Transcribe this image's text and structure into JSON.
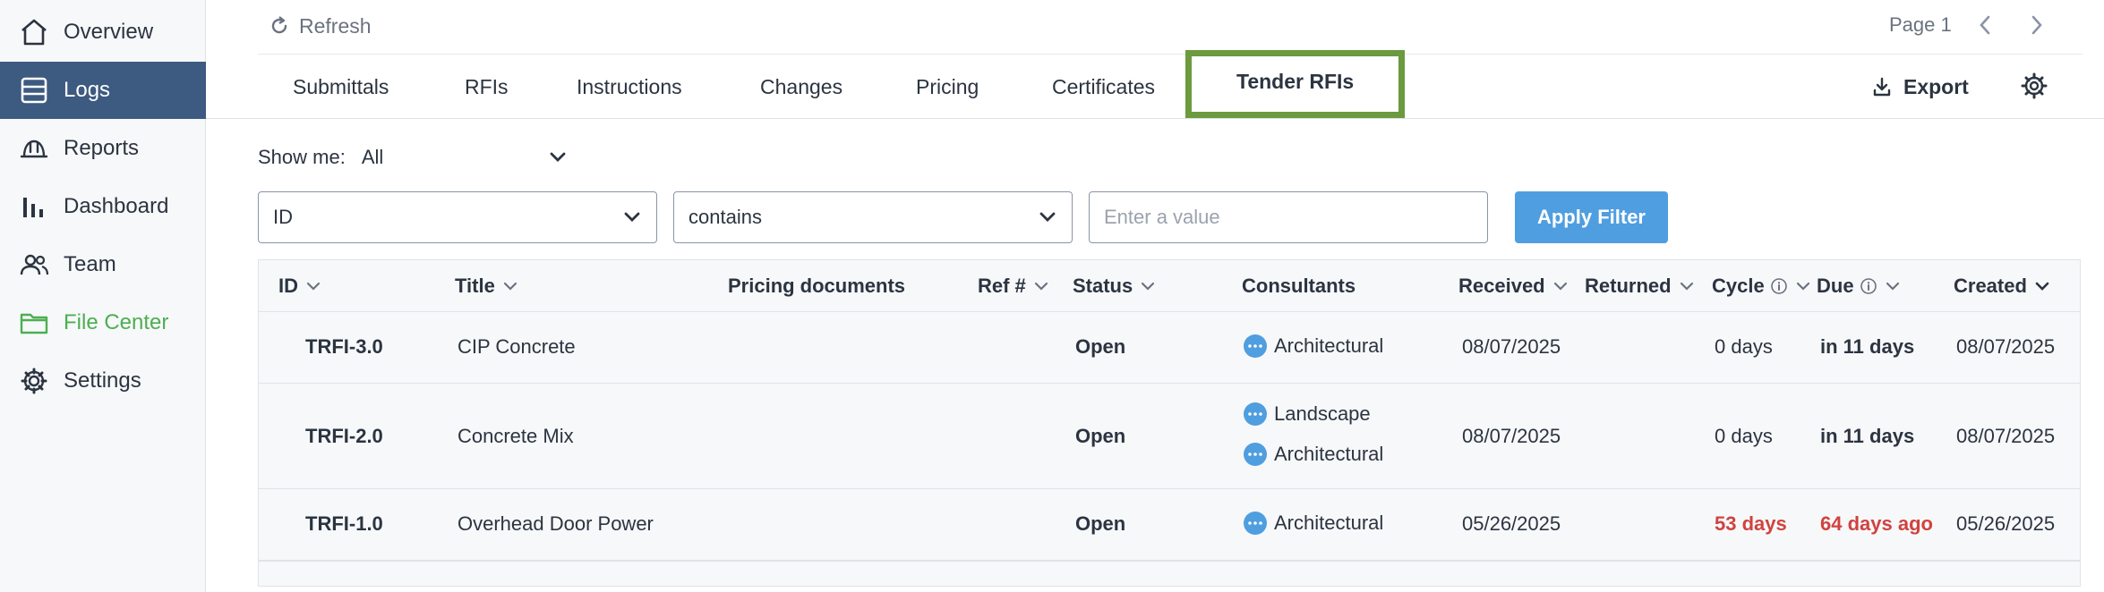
{
  "sidebar": {
    "items": [
      {
        "label": "Overview",
        "icon": "home-icon"
      },
      {
        "label": "Logs",
        "icon": "logs-icon",
        "active": true
      },
      {
        "label": "Reports",
        "icon": "hard-hat-icon"
      },
      {
        "label": "Dashboard",
        "icon": "bar-chart-icon"
      },
      {
        "label": "Team",
        "icon": "team-icon"
      },
      {
        "label": "File Center",
        "icon": "folder-icon"
      },
      {
        "label": "Settings",
        "icon": "gear-icon"
      }
    ]
  },
  "toolbar": {
    "refresh_label": "Refresh",
    "page_label": "Page 1",
    "export_label": "Export"
  },
  "tabs": [
    {
      "label": "Submittals"
    },
    {
      "label": "RFIs"
    },
    {
      "label": "Instructions"
    },
    {
      "label": "Changes"
    },
    {
      "label": "Pricing"
    },
    {
      "label": "Certificates"
    },
    {
      "label": "Tender RFIs",
      "active": true
    }
  ],
  "show_me": {
    "label": "Show me:",
    "value": "All"
  },
  "filter": {
    "field": "ID",
    "operator": "contains",
    "value_placeholder": "Enter a value",
    "apply_label": "Apply Filter"
  },
  "table": {
    "columns": {
      "id": "ID",
      "title": "Title",
      "pricing_documents": "Pricing documents",
      "ref": "Ref #",
      "status": "Status",
      "consultants": "Consultants",
      "received": "Received",
      "returned": "Returned",
      "cycle": "Cycle",
      "due": "Due",
      "created": "Created"
    },
    "rows": [
      {
        "id": "TRFI-3.0",
        "title": "CIP Concrete",
        "status": "Open",
        "consultants": [
          "Architectural"
        ],
        "received": "08/07/2025",
        "cycle": "0 days",
        "due": "in 11 days",
        "created": "08/07/2025",
        "overdue": false
      },
      {
        "id": "TRFI-2.0",
        "title": "Concrete Mix",
        "status": "Open",
        "consultants": [
          "Landscape",
          "Architectural"
        ],
        "received": "08/07/2025",
        "cycle": "0 days",
        "due": "in 11 days",
        "created": "08/07/2025",
        "overdue": false
      },
      {
        "id": "TRFI-1.0",
        "title": "Overhead Door Power",
        "status": "Open",
        "consultants": [
          "Architectural"
        ],
        "received": "05/26/2025",
        "cycle": "53 days",
        "due": "64 days ago",
        "created": "05/26/2025",
        "overdue": true
      }
    ]
  },
  "colors": {
    "sidebar_active": "#3d5a80",
    "tab_highlight": "#6b9a3f",
    "accent_blue": "#4f9ee0",
    "overdue_red": "#d0433f",
    "file_center_green": "#4caf50"
  }
}
